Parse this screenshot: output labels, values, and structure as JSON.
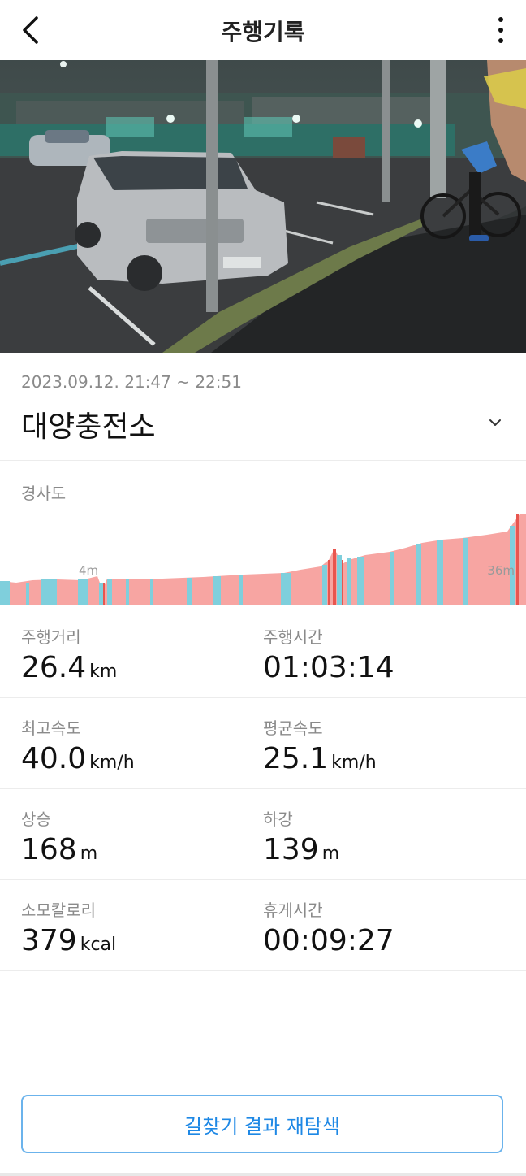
{
  "header": {
    "title": "주행기록",
    "back_icon": "chevron-left-icon",
    "more_icon": "more-vertical-icon"
  },
  "photo": {
    "description_icon": "ride-photo"
  },
  "ride": {
    "datetime": "2023.09.12. 21:47 ~ 22:51",
    "place": "대양충전소",
    "dropdown_icon": "chevron-down-icon"
  },
  "slope": {
    "title": "경사도",
    "min_label": "4m",
    "max_label": "36m",
    "colors": {
      "up": "#f7a5a2",
      "down": "#7fcfdc",
      "steep": "#e8564f"
    }
  },
  "stats": {
    "distance": {
      "label": "주행거리",
      "value": "26.4",
      "unit": "km"
    },
    "duration": {
      "label": "주행시간",
      "value": "01:03:14",
      "unit": ""
    },
    "max_speed": {
      "label": "최고속도",
      "value": "40.0",
      "unit": "km/h"
    },
    "avg_speed": {
      "label": "평균속도",
      "value": "25.1",
      "unit": "km/h"
    },
    "ascent": {
      "label": "상승",
      "value": "168",
      "unit": "m"
    },
    "descent": {
      "label": "하강",
      "value": "139",
      "unit": "m"
    },
    "calories": {
      "label": "소모칼로리",
      "value": "379",
      "unit": "kcal"
    },
    "rest_time": {
      "label": "휴게시간",
      "value": "00:09:27",
      "unit": ""
    }
  },
  "actions": {
    "reroute_label": "길찾기 결과 재탐색"
  },
  "theme": {
    "accent": "#1e88e5"
  }
}
